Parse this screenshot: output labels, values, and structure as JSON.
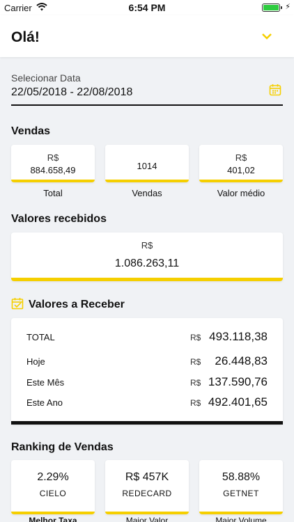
{
  "status_bar": {
    "carrier": "Carrier",
    "time": "6:54 PM"
  },
  "header": {
    "title": "Olá!"
  },
  "date": {
    "label": "Selecionar Data",
    "value": "22/05/2018 - 22/08/2018"
  },
  "vendas": {
    "title": "Vendas",
    "cards": [
      {
        "currency": "R$",
        "value": "884.658,49",
        "caption": "Total"
      },
      {
        "currency": "",
        "value": "1014",
        "caption": "Vendas"
      },
      {
        "currency": "R$",
        "value": "401,02",
        "caption": "Valor médio"
      }
    ]
  },
  "recebidos": {
    "title": "Valores recebidos",
    "currency": "R$",
    "value": "1.086.263,11"
  },
  "receber": {
    "title": "Valores a Receber",
    "rows": [
      {
        "label": "TOTAL",
        "currency": "R$",
        "value": "493.118,38"
      },
      {
        "label": "Hoje",
        "currency": "R$",
        "value": "26.448,83"
      },
      {
        "label": "Este Mês",
        "currency": "R$",
        "value": "137.590,76"
      },
      {
        "label": "Este Ano",
        "currency": "R$",
        "value": "492.401,65"
      }
    ]
  },
  "ranking": {
    "title": "Ranking de Vendas",
    "cards": [
      {
        "value": "2.29%",
        "name": "CIELO",
        "caption": "Melhor Taxa"
      },
      {
        "value": "R$ 457K",
        "name": "REDECARD",
        "caption": "Maior Valor"
      },
      {
        "value": "58.88%",
        "name": "GETNET",
        "caption": "Maior Volume"
      }
    ]
  },
  "colors": {
    "accent": "#f5cf00",
    "background": "#f0f2f5",
    "dark_bar": "#111111"
  }
}
